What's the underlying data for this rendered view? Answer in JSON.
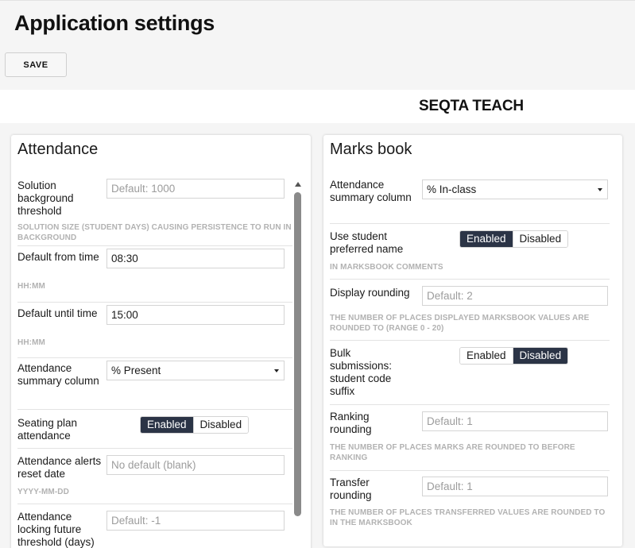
{
  "header": {
    "title": "Application settings",
    "save_label": "SAVE"
  },
  "band": {
    "title": "SEQTA TEACH"
  },
  "attendance": {
    "title": "Attendance",
    "rows": [
      {
        "label": "Solution background threshold",
        "placeholder": "Default: 1000",
        "hint": "SOLUTION SIZE (STUDENT DAYS) CAUSING PERSISTENCE TO RUN IN BACKGROUND"
      },
      {
        "label": "Default from time",
        "value": "08:30",
        "hint": "HH:MM"
      },
      {
        "label": "Default until time",
        "value": "15:00",
        "hint": "HH:MM"
      },
      {
        "label": "Attendance summary column",
        "value": "% Present"
      },
      {
        "label": "Seating plan attendance",
        "enabled_label": "Enabled",
        "disabled_label": "Disabled",
        "state": "Enabled"
      },
      {
        "label": "Attendance alerts reset date",
        "placeholder": "No default (blank)",
        "hint": "YYYY-MM-DD"
      },
      {
        "label": "Attendance locking future threshold (days)",
        "placeholder": "Default: -1"
      }
    ]
  },
  "marksbook": {
    "title": "Marks book",
    "rows": [
      {
        "label": "Attendance summary column",
        "value": "% In-class"
      },
      {
        "label": "Use student preferred name",
        "enabled_label": "Enabled",
        "disabled_label": "Disabled",
        "state": "Enabled",
        "hint": "IN MARKSBOOK COMMENTS"
      },
      {
        "label": "Display rounding",
        "placeholder": "Default: 2",
        "hint": "THE NUMBER OF PLACES DISPLAYED MARKSBOOK VALUES ARE ROUNDED TO (RANGE 0 - 20)"
      },
      {
        "label": "Bulk submissions: student code suffix",
        "enabled_label": "Enabled",
        "disabled_label": "Disabled",
        "state": "Disabled"
      },
      {
        "label": "Ranking rounding",
        "placeholder": "Default: 1",
        "hint": "THE NUMBER OF PLACES MARKS ARE ROUNDED TO BEFORE RANKING"
      },
      {
        "label": "Transfer rounding",
        "placeholder": "Default: 1",
        "hint": "THE NUMBER OF PLACES TRANSFERRED VALUES ARE ROUNDED TO IN THE MARKSBOOK"
      }
    ]
  },
  "colors": {
    "accent": "#2b3446",
    "hint": "#b2b2b2",
    "background": "#f5f5f5"
  }
}
